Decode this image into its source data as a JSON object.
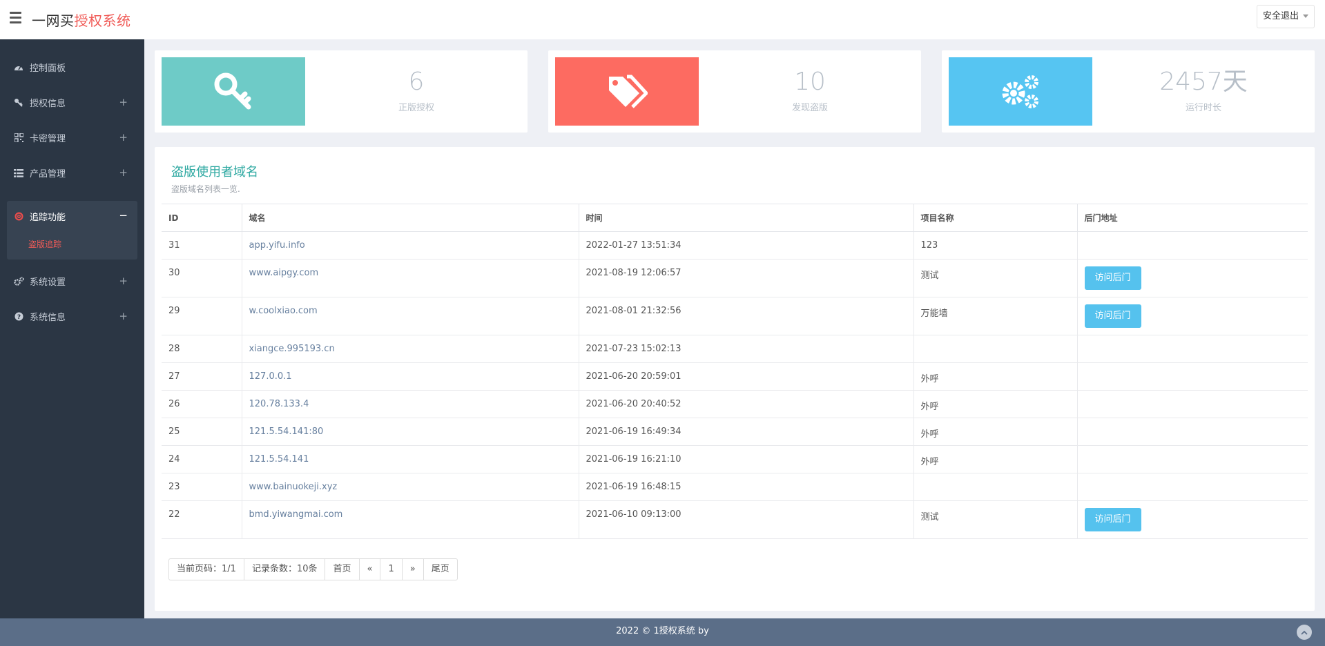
{
  "header": {
    "brand_main": "一网买",
    "brand_accent": "授权系统",
    "logout_label": "安全退出"
  },
  "sidebar": {
    "items": [
      {
        "label": "控制面板",
        "icon": "dashboard-icon",
        "toggle": ""
      },
      {
        "label": "授权信息",
        "icon": "key-icon",
        "toggle": "+"
      },
      {
        "label": "卡密管理",
        "icon": "qrcode-icon",
        "toggle": "+"
      },
      {
        "label": "产品管理",
        "icon": "list-icon",
        "toggle": "+"
      },
      {
        "label": "追踪功能",
        "icon": "target-icon",
        "toggle": "−",
        "expanded": true,
        "sub": [
          {
            "label": "盗版追踪"
          }
        ]
      },
      {
        "label": "系统设置",
        "icon": "gears-icon",
        "toggle": "+"
      },
      {
        "label": "系统信息",
        "icon": "question-circle-icon",
        "toggle": "+"
      }
    ]
  },
  "stats": [
    {
      "value": "6",
      "label": "正版授权",
      "color": "#6ecbc7",
      "icon": "key-icon"
    },
    {
      "value": "10",
      "label": "发现盗版",
      "color": "#fd6b61",
      "icon": "tags-icon"
    },
    {
      "value": "2457天",
      "label": "运行时长",
      "color": "#56c5f2",
      "icon": "gears-icon"
    }
  ],
  "panel": {
    "title": "盗版使用者域名",
    "subtitle": "盗版域名列表一览.",
    "columns": [
      "ID",
      "域名",
      "时间",
      "项目名称",
      "后门地址"
    ],
    "rows": [
      {
        "id": "31",
        "domain": "app.yifu.info",
        "time": "2022-01-27 13:51:34",
        "project": "123",
        "backdoor": ""
      },
      {
        "id": "30",
        "domain": "www.aipgy.com",
        "time": "2021-08-19 12:06:57",
        "project": "测试",
        "backdoor": "访问后门"
      },
      {
        "id": "29",
        "domain": "w.coolxiao.com",
        "time": "2021-08-01 21:32:56",
        "project": "万能墙",
        "backdoor": "访问后门"
      },
      {
        "id": "28",
        "domain": "xiangce.995193.cn",
        "time": "2021-07-23 15:02:13",
        "project": "",
        "backdoor": ""
      },
      {
        "id": "27",
        "domain": "127.0.0.1",
        "time": "2021-06-20 20:59:01",
        "project": "外呼",
        "backdoor": ""
      },
      {
        "id": "26",
        "domain": "120.78.133.4",
        "time": "2021-06-20 20:40:52",
        "project": "外呼",
        "backdoor": ""
      },
      {
        "id": "25",
        "domain": "121.5.54.141:80",
        "time": "2021-06-19 16:49:34",
        "project": "外呼",
        "backdoor": ""
      },
      {
        "id": "24",
        "domain": "121.5.54.141",
        "time": "2021-06-19 16:21:10",
        "project": "外呼",
        "backdoor": ""
      },
      {
        "id": "23",
        "domain": "www.bainuokeji.xyz",
        "time": "2021-06-19 16:48:15",
        "project": "",
        "backdoor": ""
      },
      {
        "id": "22",
        "domain": "bmd.yiwangmai.com",
        "time": "2021-06-10 09:13:00",
        "project": "测试",
        "backdoor": "访问后门"
      }
    ]
  },
  "pager": {
    "current": "当前页码：1/1",
    "records": "记录条数：10条",
    "first": "首页",
    "prev": "«",
    "page": "1",
    "next": "»",
    "last": "尾页"
  },
  "footer": {
    "text": "2022 © 1授权系统 by"
  }
}
